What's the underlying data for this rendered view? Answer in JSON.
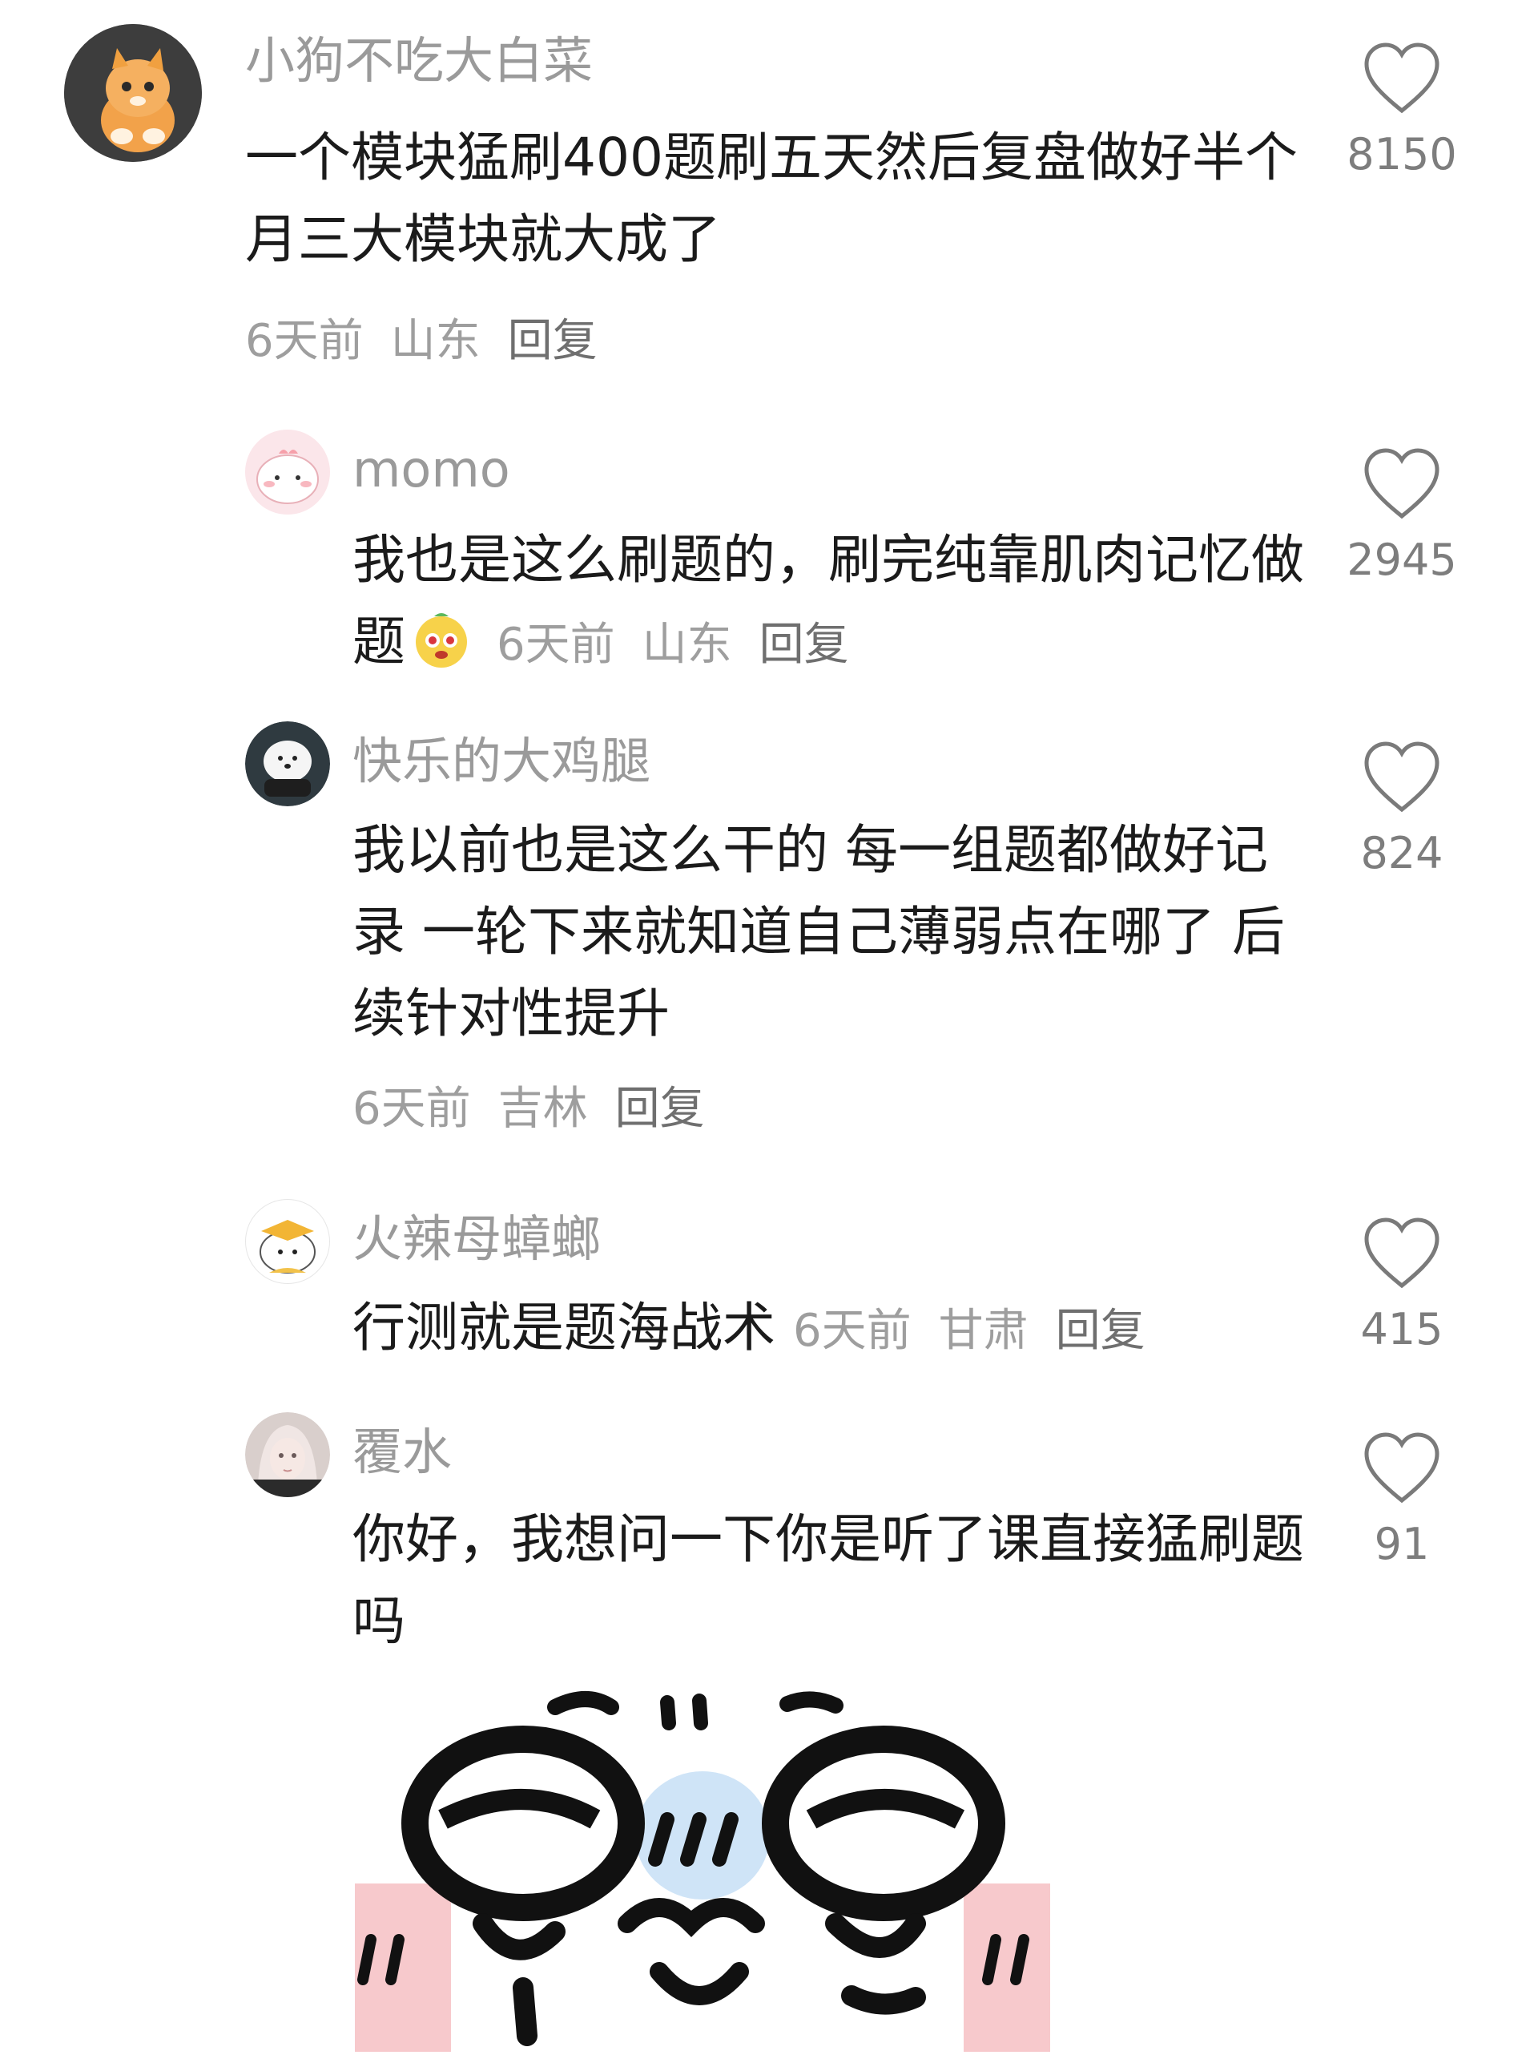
{
  "comments": [
    {
      "username": "小狗不吃大白菜",
      "text": "一个模块猛刷400题刷五天然后复盘做好半个月三大模块就大成了",
      "time": "6天前",
      "location": "山东",
      "reply": "回复",
      "likes": "8150"
    },
    {
      "username": "momo",
      "text": "我也是这么刷题的，刷完纯靠肌肉记忆做题",
      "time": "6天前",
      "location": "山东",
      "reply": "回复",
      "likes": "2945"
    },
    {
      "username": "快乐的大鸡腿",
      "text": "我以前也是这么干的 每一组题都做好记录 一轮下来就知道自己薄弱点在哪了 后续针对性提升",
      "time": "6天前",
      "location": "吉林",
      "reply": "回复",
      "likes": "824"
    },
    {
      "username": "火辣母蟑螂",
      "text": "行测就是题海战术",
      "time": "6天前",
      "location": "甘肃",
      "reply": "回复",
      "likes": "415"
    },
    {
      "username": "覆水",
      "text": "你好，我想问一下你是听了课直接猛刷题吗",
      "likes": "91"
    }
  ],
  "colors": {
    "username": "#9a9a9a",
    "text": "#1b1b1b",
    "meta": "#9e9e9e",
    "heart": "#7a7a7a"
  },
  "icons": {
    "like": "heart-outline-icon",
    "emoji": "crying-face-emoji",
    "sticker": "cartoon-faces-sticker"
  }
}
